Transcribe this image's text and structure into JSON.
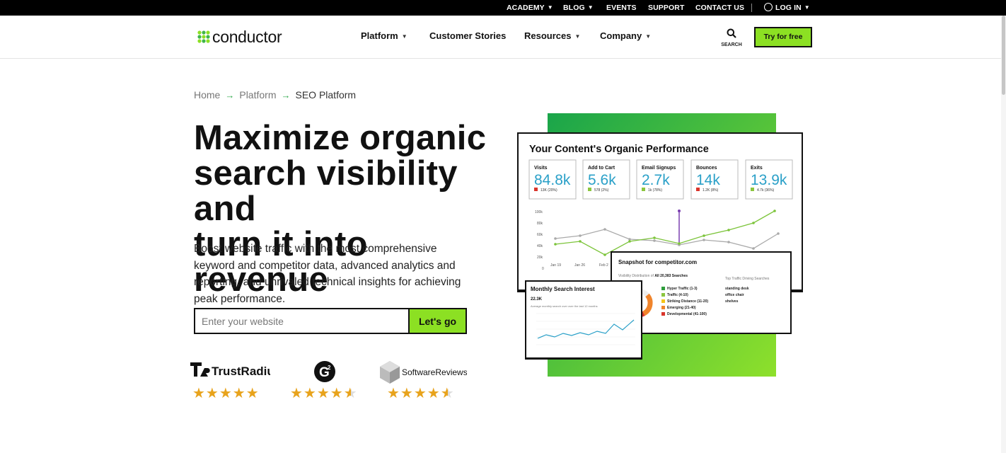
{
  "topbar": {
    "links": [
      "ACADEMY",
      "BLOG",
      "EVENTS",
      "SUPPORT",
      "CONTACT US"
    ],
    "login": "LOG IN"
  },
  "header": {
    "logo_text": "conductor",
    "nav": [
      "Platform",
      "Customer Stories",
      "Resources",
      "Company"
    ],
    "search_label": "SEARCH",
    "cta": "Try for free"
  },
  "breadcrumb": [
    "Home",
    "Platform",
    "SEO Platform"
  ],
  "hero": {
    "title_lines": [
      "Maximize organic",
      "search visibility and",
      "turn it into revenue"
    ],
    "description": "Boost website traffic with the most comprehensive keyword and competitor data, advanced analytics and reporting, and unrivaled technical insights for achieving peak performance.",
    "input_placeholder": "Enter your website",
    "button": "Let's go"
  },
  "reviews": [
    {
      "name": "TrustRadius",
      "rating": 5
    },
    {
      "name": "G2",
      "rating": 4.5
    },
    {
      "name": "SoftwareReviews",
      "rating": 4.5
    }
  ],
  "dashboard": {
    "title": "Your Content's Organic Performance",
    "kpis": [
      {
        "label": "Visits",
        "value": "84.8k",
        "delta": "13K (20%)",
        "trend": "down"
      },
      {
        "label": "Add to Cart",
        "value": "5.6k",
        "delta": "578 (2%)",
        "trend": "up"
      },
      {
        "label": "Email Signups",
        "value": "2.7k",
        "delta": "1k (78%)",
        "trend": "up"
      },
      {
        "label": "Bounces",
        "value": "14k",
        "delta": "1.2K (8%)",
        "trend": "down"
      },
      {
        "label": "Exits",
        "value": "13.9k",
        "delta": "4.7k (36%)",
        "trend": "up"
      }
    ],
    "y_ticks": [
      "100k",
      "80k",
      "60k",
      "40k",
      "20k",
      "0"
    ],
    "x_ticks": [
      "Jan 19",
      "Jan 26",
      "Feb 2"
    ],
    "snapshot": {
      "title": "Snapshot for competitor.com",
      "subtitle_prefix": "Visibility Distribution of ",
      "subtitle_bold": "All 20,383 Searches",
      "right_header": "Top Traffic Driving Searches",
      "legend": [
        {
          "label": "Hyper Traffic (1-3)",
          "color": "#2e9e3c"
        },
        {
          "label": "Traffic (4-10)",
          "color": "#8cc63f"
        },
        {
          "label": "Striking Distance (11-20)",
          "color": "#f5c518"
        },
        {
          "label": "Emerging (21-40)",
          "color": "#f0842b"
        },
        {
          "label": "Developmental (41-100)",
          "color": "#d9342b"
        }
      ],
      "searches": [
        "standing desk",
        "office chair",
        "shelves"
      ]
    },
    "monthly": {
      "title": "Monthly Search Interest",
      "value": "22.3K",
      "caption": "Average monthly search over over the last 12 months"
    }
  },
  "colors": {
    "brand_green": "#8ce023",
    "breadcrumb_arrow": "#2ea84a",
    "star": "#e8a31c"
  }
}
